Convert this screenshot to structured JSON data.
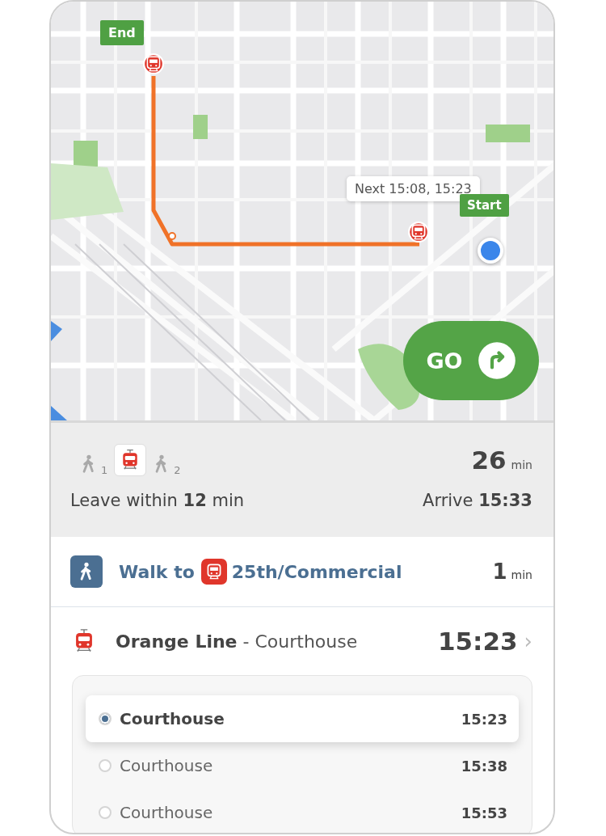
{
  "map": {
    "end_pin": "End",
    "start_pin": "Start",
    "departure_tooltip": "Next 15:08, 15:23",
    "go_button": "GO"
  },
  "summary": {
    "legs": [
      {
        "kind": "walk",
        "count": "1"
      },
      {
        "kind": "train"
      },
      {
        "kind": "walk",
        "count": "2"
      }
    ],
    "duration": "26",
    "duration_unit": "min",
    "leave": "Leave within **12** min",
    "arrive": "Arrive **15:33**"
  },
  "walk_step": {
    "prefix": "Walk to",
    "stop": "25th/Commercial",
    "duration": "1",
    "unit": "min"
  },
  "line": {
    "title": "**Orange Line** - Courthouse",
    "time": "15:23",
    "chevron": "›"
  },
  "departures": [
    {
      "destination": "Courthouse",
      "time": "15:23",
      "selected": true
    },
    {
      "destination": "Courthouse",
      "time": "15:38",
      "selected": false
    },
    {
      "destination": "Courthouse",
      "time": "15:53",
      "selected": false
    }
  ]
}
